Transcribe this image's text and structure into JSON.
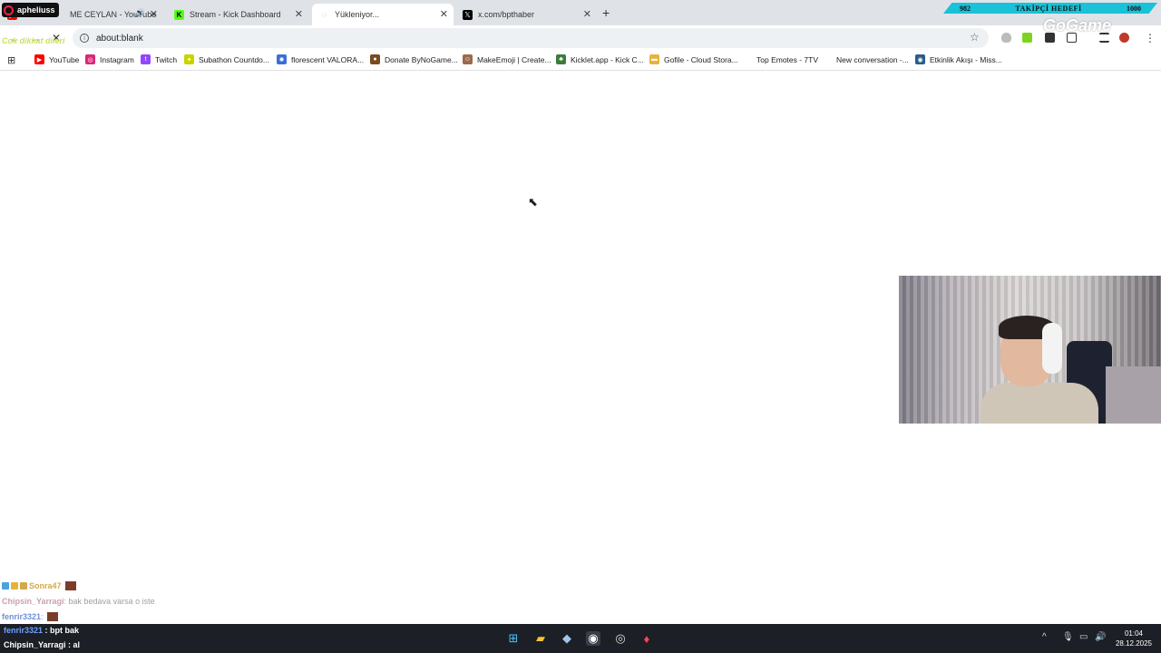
{
  "overlay": {
    "username": "apheliuss",
    "follower_goal": {
      "current": "982",
      "label": "TAKİPÇİ HEDEFİ",
      "target": "1000"
    },
    "top_left_text": "Cok dikkat dileri",
    "logo_text": "GoGame"
  },
  "tabs": [
    {
      "title": "ME CEYLAN - YouTube",
      "icon": "youtube-icon",
      "active": false,
      "playing_audio": true
    },
    {
      "title": "Stream - Kick Dashboard",
      "icon": "kick-icon",
      "active": false
    },
    {
      "title": "Yükleniyor...",
      "icon": "loading-icon",
      "active": true
    },
    {
      "title": "x.com/bpthaber",
      "icon": "x-icon",
      "active": false
    }
  ],
  "omnibox": {
    "url": "about:blank"
  },
  "bookmarks": [
    {
      "label": "YouTube",
      "icon": "youtube-icon",
      "color": "#ff0000"
    },
    {
      "label": "Instagram",
      "icon": "instagram-icon",
      "color": "#d62976"
    },
    {
      "label": "Twitch",
      "icon": "twitch-icon",
      "color": "#9146ff"
    },
    {
      "label": "Subathon Countdo...",
      "icon": "subathon-icon",
      "color": "#c8d400"
    },
    {
      "label": "florescent VALORA...",
      "icon": "gear-icon",
      "color": "#3b6fd8"
    },
    {
      "label": "Donate ByNoGame...",
      "icon": "donate-icon",
      "color": "#7a4b1e"
    },
    {
      "label": "MakeEmoji | Create...",
      "icon": "makeemoji-icon",
      "color": "#9a6a4a"
    },
    {
      "label": "Kicklet.app - Kick C...",
      "icon": "kicklet-icon",
      "color": "#3a7d3a"
    },
    {
      "label": "Gofile - Cloud Stora...",
      "icon": "folder-icon",
      "color": "#e8b23a"
    },
    {
      "label": "Top Emotes - 7TV",
      "icon": "7tv-icon",
      "color": "#ffffff"
    },
    {
      "label": "New conversation -...",
      "icon": "chat-icon",
      "color": "#ffffff"
    },
    {
      "label": "Etkinlik Akışı - Miss...",
      "icon": "globe-icon",
      "color": "#2a5c8a"
    }
  ],
  "chat": [
    {
      "user": "Sonra47",
      "message": "",
      "has_emote": true
    },
    {
      "user": "Chipsin_Yarragi",
      "message": ": bak bedava varsa o iste",
      "has_emote": false
    },
    {
      "user": "fenrir3321",
      "message": ":",
      "has_emote": true
    }
  ],
  "taskbar_chat": [
    {
      "user": "fenrir3321",
      "message": ": bpt bak"
    },
    {
      "user": "Chipsin_Yarragi",
      "message": ": al"
    }
  ],
  "clock": {
    "time": "01:04",
    "date": "28.12.2025"
  }
}
